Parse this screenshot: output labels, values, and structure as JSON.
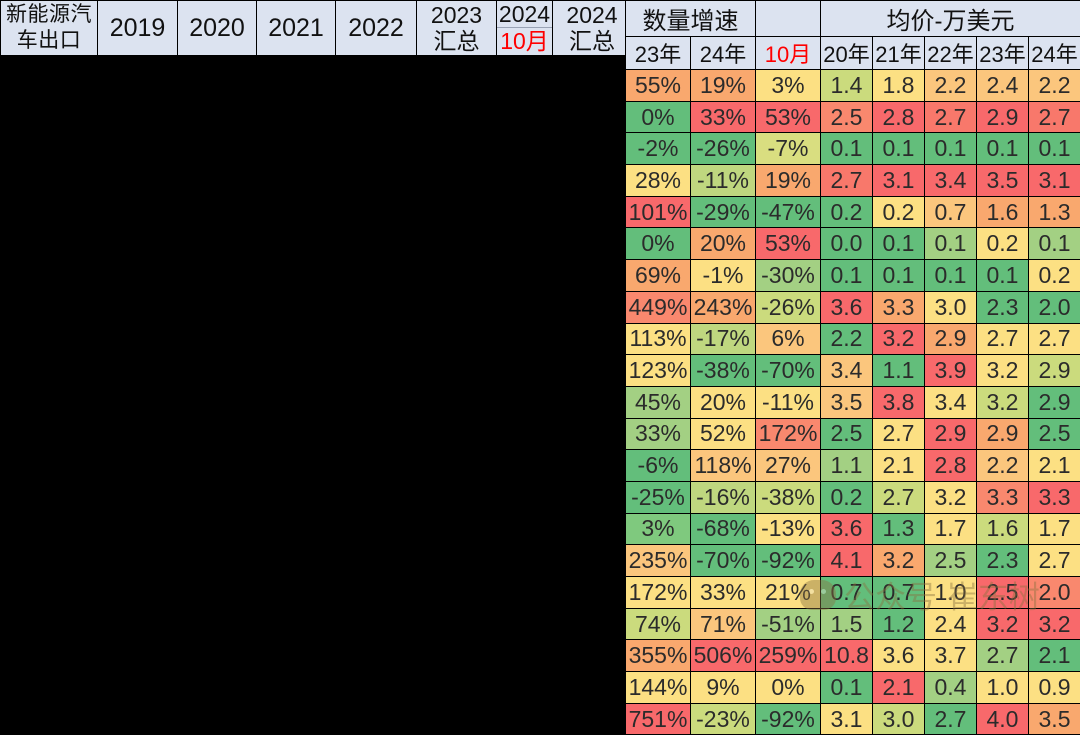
{
  "left_header": {
    "title_line1": "新能源汽",
    "title_line2": "车出口",
    "columns": [
      {
        "name": "col-2019",
        "line1": "2019",
        "line2": ""
      },
      {
        "name": "col-2020",
        "line1": "2020",
        "line2": ""
      },
      {
        "name": "col-2021",
        "line1": "2021",
        "line2": ""
      },
      {
        "name": "col-2022",
        "line1": "2022",
        "line2": ""
      },
      {
        "name": "col-2023-total",
        "line1": "2023",
        "line2": "汇总"
      },
      {
        "name": "col-2024-oct",
        "line1": "2024",
        "line2": "10月",
        "line2_color": "#FF0000"
      },
      {
        "name": "col-2024-total",
        "line1": "2024",
        "line2": "汇总"
      }
    ]
  },
  "right_header": {
    "group1": "数量增速",
    "group2": "均价-万美元",
    "group_blank": "",
    "sub": [
      "23年",
      "24年",
      "10月",
      "20年",
      "21年",
      "22年",
      "23年",
      "24年"
    ],
    "sub_red_index": 2
  },
  "colors": {
    "header_bg": "#DCE3F0",
    "red": "#F8696B",
    "orange": "#F9A86E",
    "light_orange": "#FBC67D",
    "yellow": "#FCE083",
    "light_yellow": "#FAE084",
    "yellow_green": "#CBDB7D",
    "light_green": "#A3D083",
    "green": "#63BE7B",
    "grid": "#000000",
    "text": "#2b2b2b",
    "accent_red_text": "#FF0000",
    "watermark": "#8a7140"
  },
  "chart_data": {
    "type": "heatmap",
    "title": "新能源汽车出口",
    "column_groups": [
      "数量增速",
      "均价-万美元"
    ],
    "columns": [
      "23年",
      "24年",
      "10月",
      "20年",
      "21年",
      "22年",
      "23年",
      "24年"
    ],
    "row_count": 19,
    "rows": [
      {
        "cells": [
          {
            "v": "55%",
            "c": "#F9A86E"
          },
          {
            "v": "19%",
            "c": "#F9A86E"
          },
          {
            "v": "3%",
            "c": "#FCE083"
          },
          {
            "v": "1.4",
            "c": "#CBDB7D"
          },
          {
            "v": "1.8",
            "c": "#FCE083"
          },
          {
            "v": "2.2",
            "c": "#FBC67D"
          },
          {
            "v": "2.4",
            "c": "#FBC67D"
          },
          {
            "v": "2.2",
            "c": "#FBC67D"
          }
        ]
      },
      {
        "cells": [
          {
            "v": "0%",
            "c": "#63BE7B"
          },
          {
            "v": "33%",
            "c": "#F8696B"
          },
          {
            "v": "53%",
            "c": "#F8696B"
          },
          {
            "v": "2.5",
            "c": "#F9886E"
          },
          {
            "v": "2.8",
            "c": "#F8696B"
          },
          {
            "v": "2.7",
            "c": "#F8786B"
          },
          {
            "v": "2.9",
            "c": "#F8696B"
          },
          {
            "v": "2.7",
            "c": "#F8786B"
          }
        ]
      },
      {
        "cells": [
          {
            "v": "-2%",
            "c": "#63BE7B"
          },
          {
            "v": "-26%",
            "c": "#63BE7B"
          },
          {
            "v": "-7%",
            "c": "#D9DE80"
          },
          {
            "v": "0.1",
            "c": "#63BE7B"
          },
          {
            "v": "0.1",
            "c": "#63BE7B"
          },
          {
            "v": "0.1",
            "c": "#63BE7B"
          },
          {
            "v": "0.1",
            "c": "#63BE7B"
          },
          {
            "v": "0.1",
            "c": "#63BE7B"
          }
        ]
      },
      {
        "cells": [
          {
            "v": "28%",
            "c": "#FCE083"
          },
          {
            "v": "-11%",
            "c": "#BFD77F"
          },
          {
            "v": "19%",
            "c": "#F9A86E"
          },
          {
            "v": "2.7",
            "c": "#F8786B"
          },
          {
            "v": "3.1",
            "c": "#F8696B"
          },
          {
            "v": "3.4",
            "c": "#F8696B"
          },
          {
            "v": "3.5",
            "c": "#F8696B"
          },
          {
            "v": "3.1",
            "c": "#F8696B"
          }
        ]
      },
      {
        "cells": [
          {
            "v": "101%",
            "c": "#F8696B"
          },
          {
            "v": "-29%",
            "c": "#63BE7B"
          },
          {
            "v": "-47%",
            "c": "#63BE7B"
          },
          {
            "v": "0.2",
            "c": "#63BE7B"
          },
          {
            "v": "0.2",
            "c": "#FCE083"
          },
          {
            "v": "0.7",
            "c": "#FBC67D"
          },
          {
            "v": "1.6",
            "c": "#F9A86E"
          },
          {
            "v": "1.3",
            "c": "#F9A86E"
          }
        ]
      },
      {
        "cells": [
          {
            "v": "0%",
            "c": "#63BE7B"
          },
          {
            "v": "20%",
            "c": "#F9A86E"
          },
          {
            "v": "53%",
            "c": "#F8696B"
          },
          {
            "v": "0.0",
            "c": "#63BE7B"
          },
          {
            "v": "0.1",
            "c": "#63BE7B"
          },
          {
            "v": "0.1",
            "c": "#A3D083"
          },
          {
            "v": "0.2",
            "c": "#FCE083"
          },
          {
            "v": "0.1",
            "c": "#A3D083"
          }
        ]
      },
      {
        "cells": [
          {
            "v": "69%",
            "c": "#F9A86E"
          },
          {
            "v": "-1%",
            "c": "#FCE083"
          },
          {
            "v": "-30%",
            "c": "#A3D083"
          },
          {
            "v": "0.1",
            "c": "#63BE7B"
          },
          {
            "v": "0.1",
            "c": "#63BE7B"
          },
          {
            "v": "0.1",
            "c": "#63BE7B"
          },
          {
            "v": "0.1",
            "c": "#63BE7B"
          },
          {
            "v": "0.2",
            "c": "#FCE083"
          }
        ]
      },
      {
        "cells": [
          {
            "v": "449%",
            "c": "#F9886E"
          },
          {
            "v": "243%",
            "c": "#F9A86E"
          },
          {
            "v": "-26%",
            "c": "#CBDB7D"
          },
          {
            "v": "3.6",
            "c": "#F8696B"
          },
          {
            "v": "3.3",
            "c": "#F9A86E"
          },
          {
            "v": "3.0",
            "c": "#FCE083"
          },
          {
            "v": "2.3",
            "c": "#63BE7B"
          },
          {
            "v": "2.0",
            "c": "#63BE7B"
          }
        ]
      },
      {
        "cells": [
          {
            "v": "113%",
            "c": "#FCE083"
          },
          {
            "v": "-17%",
            "c": "#BFD77F"
          },
          {
            "v": "6%",
            "c": "#FBC67D"
          },
          {
            "v": "2.2",
            "c": "#63BE7B"
          },
          {
            "v": "3.2",
            "c": "#F8696B"
          },
          {
            "v": "2.9",
            "c": "#F9A86E"
          },
          {
            "v": "2.7",
            "c": "#FCE083"
          },
          {
            "v": "2.7",
            "c": "#FCE083"
          }
        ]
      },
      {
        "cells": [
          {
            "v": "123%",
            "c": "#FCE083"
          },
          {
            "v": "-38%",
            "c": "#63BE7B"
          },
          {
            "v": "-70%",
            "c": "#63BE7B"
          },
          {
            "v": "3.4",
            "c": "#FBC67D"
          },
          {
            "v": "1.1",
            "c": "#63BE7B"
          },
          {
            "v": "3.9",
            "c": "#F8696B"
          },
          {
            "v": "3.2",
            "c": "#FCE083"
          },
          {
            "v": "2.9",
            "c": "#CBDB7D"
          }
        ]
      },
      {
        "cells": [
          {
            "v": "45%",
            "c": "#A3D083"
          },
          {
            "v": "20%",
            "c": "#FCE083"
          },
          {
            "v": "-11%",
            "c": "#FCE083"
          },
          {
            "v": "3.5",
            "c": "#FBC67D"
          },
          {
            "v": "3.8",
            "c": "#F8696B"
          },
          {
            "v": "3.4",
            "c": "#FCE083"
          },
          {
            "v": "3.2",
            "c": "#CBDB7D"
          },
          {
            "v": "2.9",
            "c": "#63BE7B"
          }
        ]
      },
      {
        "cells": [
          {
            "v": "33%",
            "c": "#A3D083"
          },
          {
            "v": "52%",
            "c": "#FCE083"
          },
          {
            "v": "172%",
            "c": "#F9886E"
          },
          {
            "v": "2.5",
            "c": "#63BE7B"
          },
          {
            "v": "2.7",
            "c": "#FCE083"
          },
          {
            "v": "2.9",
            "c": "#F8696B"
          },
          {
            "v": "2.9",
            "c": "#F9A86E"
          },
          {
            "v": "2.5",
            "c": "#63BE7B"
          }
        ]
      },
      {
        "cells": [
          {
            "v": "-6%",
            "c": "#63BE7B"
          },
          {
            "v": "118%",
            "c": "#FBC67D"
          },
          {
            "v": "27%",
            "c": "#FBC67D"
          },
          {
            "v": "1.1",
            "c": "#A3D083"
          },
          {
            "v": "2.1",
            "c": "#FCE083"
          },
          {
            "v": "2.8",
            "c": "#F8696B"
          },
          {
            "v": "2.2",
            "c": "#FBC67D"
          },
          {
            "v": "2.1",
            "c": "#FCE083"
          }
        ]
      },
      {
        "cells": [
          {
            "v": "-25%",
            "c": "#63BE7B"
          },
          {
            "v": "-16%",
            "c": "#BFD77F"
          },
          {
            "v": "-38%",
            "c": "#CBDB7D"
          },
          {
            "v": "0.2",
            "c": "#63BE7B"
          },
          {
            "v": "2.7",
            "c": "#CBDB7D"
          },
          {
            "v": "3.2",
            "c": "#FCE083"
          },
          {
            "v": "3.3",
            "c": "#F9886E"
          },
          {
            "v": "3.3",
            "c": "#F8696B"
          }
        ]
      },
      {
        "cells": [
          {
            "v": "3%",
            "c": "#7FC97E"
          },
          {
            "v": "-68%",
            "c": "#63BE7B"
          },
          {
            "v": "-13%",
            "c": "#FCE083"
          },
          {
            "v": "3.6",
            "c": "#F8696B"
          },
          {
            "v": "1.3",
            "c": "#63BE7B"
          },
          {
            "v": "1.7",
            "c": "#FCE083"
          },
          {
            "v": "1.6",
            "c": "#CBDB7D"
          },
          {
            "v": "1.7",
            "c": "#FCE083"
          }
        ]
      },
      {
        "cells": [
          {
            "v": "235%",
            "c": "#FBC67D"
          },
          {
            "v": "-70%",
            "c": "#63BE7B"
          },
          {
            "v": "-92%",
            "c": "#63BE7B"
          },
          {
            "v": "4.1",
            "c": "#F8696B"
          },
          {
            "v": "3.2",
            "c": "#F9A86E"
          },
          {
            "v": "2.5",
            "c": "#A3D083"
          },
          {
            "v": "2.3",
            "c": "#63BE7B"
          },
          {
            "v": "2.7",
            "c": "#FCE083"
          }
        ]
      },
      {
        "cells": [
          {
            "v": "172%",
            "c": "#FCE083"
          },
          {
            "v": "33%",
            "c": "#FCE083"
          },
          {
            "v": "21%",
            "c": "#FCE083"
          },
          {
            "v": "0.7",
            "c": "#63BE7B"
          },
          {
            "v": "0.7",
            "c": "#63BE7B"
          },
          {
            "v": "1.0",
            "c": "#FCE083"
          },
          {
            "v": "2.5",
            "c": "#F8696B"
          },
          {
            "v": "2.0",
            "c": "#F9886E"
          }
        ]
      },
      {
        "cells": [
          {
            "v": "74%",
            "c": "#CBDB7D"
          },
          {
            "v": "71%",
            "c": "#FBC67D"
          },
          {
            "v": "-51%",
            "c": "#A3D083"
          },
          {
            "v": "1.5",
            "c": "#A3D083"
          },
          {
            "v": "1.2",
            "c": "#63BE7B"
          },
          {
            "v": "2.4",
            "c": "#FCE083"
          },
          {
            "v": "3.2",
            "c": "#F8696B"
          },
          {
            "v": "3.2",
            "c": "#F8696B"
          }
        ]
      },
      {
        "cells": [
          {
            "v": "355%",
            "c": "#F9A86E"
          },
          {
            "v": "506%",
            "c": "#F8696B"
          },
          {
            "v": "259%",
            "c": "#F8696B"
          },
          {
            "v": "10.8",
            "c": "#F8696B"
          },
          {
            "v": "3.6",
            "c": "#FCE083"
          },
          {
            "v": "3.7",
            "c": "#FCE083"
          },
          {
            "v": "2.7",
            "c": "#A3D083"
          },
          {
            "v": "2.1",
            "c": "#63BE7B"
          }
        ]
      },
      {
        "cells": [
          {
            "v": "144%",
            "c": "#FCE083"
          },
          {
            "v": "9%",
            "c": "#FCE083"
          },
          {
            "v": "0%",
            "c": "#FCE083"
          },
          {
            "v": "0.1",
            "c": "#63BE7B"
          },
          {
            "v": "2.1",
            "c": "#F8696B"
          },
          {
            "v": "0.4",
            "c": "#A3D083"
          },
          {
            "v": "1.0",
            "c": "#FCE083"
          },
          {
            "v": "0.9",
            "c": "#FCE083"
          }
        ]
      },
      {
        "cells": [
          {
            "v": "751%",
            "c": "#F8696B"
          },
          {
            "v": "-23%",
            "c": "#CBDB7D"
          },
          {
            "v": "-92%",
            "c": "#63BE7B"
          },
          {
            "v": "3.1",
            "c": "#FCE083"
          },
          {
            "v": "3.0",
            "c": "#CBDB7D"
          },
          {
            "v": "2.7",
            "c": "#63BE7B"
          },
          {
            "v": "4.0",
            "c": "#F8696B"
          },
          {
            "v": "3.5",
            "c": "#F9A86E"
          }
        ]
      }
    ]
  },
  "watermark": {
    "icon": "wechat-icon",
    "text": "公众号 崔东树"
  }
}
